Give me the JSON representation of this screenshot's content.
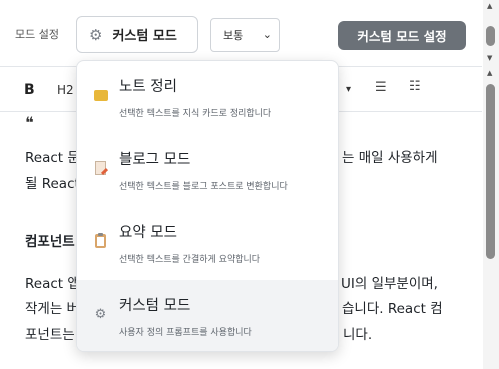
{
  "settings": {
    "mode_label": "모드 설정",
    "mode_button_label": "커스텀 모드",
    "size_select_value": "보통",
    "custom_settings_button": "커스텀 모드 설정"
  },
  "toolbar": {
    "bold": "B",
    "heading": "H2",
    "dropdown_arrow": "▾",
    "bullet_list_icon": "bullet-list-icon",
    "numbered_list_icon": "numbered-list-icon"
  },
  "editor": {
    "quote_mark": "❝",
    "para1_line1_left": "React 문",
    "para1_line1_right": "는 매일 사용하게",
    "para1_line2": "될 React",
    "heading": "컴포넌트",
    "para2_line1_left": "React 앱",
    "para2_line1_right": "UI의 일부분이며,",
    "para2_line2_left": "작게는 버",
    "para2_line2_right": "습니다. React 컴",
    "para2_line3_left": "포넌트는",
    "para2_line3_right": "니다."
  },
  "dropdown": {
    "items": [
      {
        "title": "노트 정리",
        "desc": "선택한 텍스트를 지식 카드로 정리합니다",
        "icon": "folder-icon"
      },
      {
        "title": "블로그 모드",
        "desc": "선택한 텍스트를 블로그 포스트로 변환합니다",
        "icon": "memo-icon"
      },
      {
        "title": "요약 모드",
        "desc": "선택한 텍스트를 간결하게 요약합니다",
        "icon": "clipboard-icon"
      },
      {
        "title": "커스텀 모드",
        "desc": "사용자 정의 프롬프트를 사용합니다",
        "icon": "gear-icon"
      }
    ],
    "active_index": 3
  },
  "colors": {
    "accent_button": "#6b7178",
    "active_item_bg": "#f2f3f5"
  }
}
